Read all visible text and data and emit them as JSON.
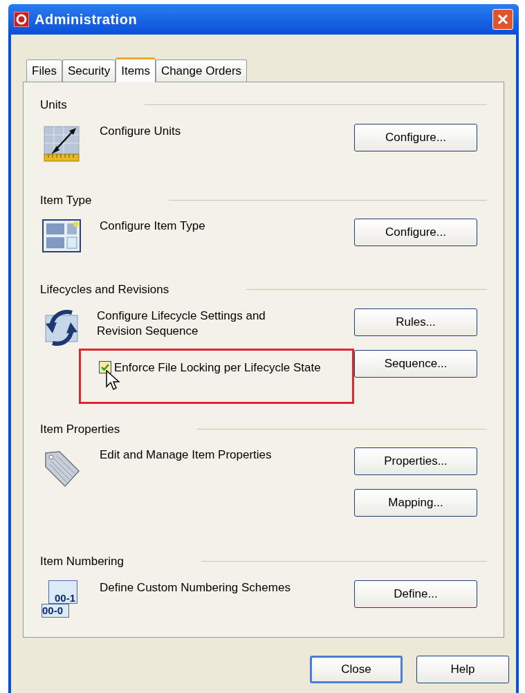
{
  "window": {
    "title": "Administration"
  },
  "tabs": [
    {
      "label": "Files",
      "selected": false
    },
    {
      "label": "Security",
      "selected": false
    },
    {
      "label": "Items",
      "selected": true
    },
    {
      "label": "Change Orders",
      "selected": false
    }
  ],
  "sections": [
    {
      "heading": "Units",
      "kind": "units",
      "description": "Configure Units",
      "buttons": [
        "Configure..."
      ]
    },
    {
      "heading": "Item Type",
      "kind": "item-type",
      "description": "Configure Item Type",
      "buttons": [
        "Configure..."
      ]
    },
    {
      "heading": "Lifecycles and Revisions",
      "kind": "lifecycle",
      "description": "Configure Lifecycle Settings and Revision Sequence",
      "buttons": [
        "Rules...",
        "Sequence..."
      ],
      "checkbox": {
        "label": "Enforce File Locking per Lifecycle State",
        "checked": true,
        "highlighted": true
      }
    },
    {
      "heading": "Item Properties",
      "kind": "tag",
      "description": "Edit and Manage Item Properties",
      "buttons": [
        "Properties...",
        "Mapping..."
      ]
    },
    {
      "heading": "Item Numbering",
      "kind": "numbering",
      "icon_text": [
        "00-1",
        "00-0"
      ],
      "description": "Define Custom Numbering Schemes",
      "buttons": [
        "Define..."
      ]
    }
  ],
  "footer_buttons": [
    {
      "label": "Close",
      "default": true
    },
    {
      "label": "Help",
      "default": false
    }
  ]
}
